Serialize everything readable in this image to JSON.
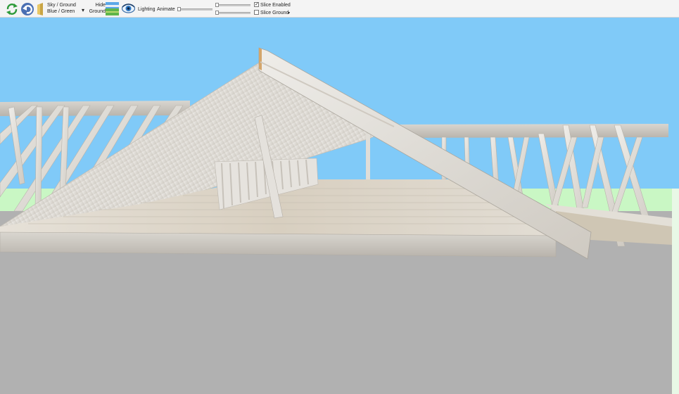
{
  "toolbar": {
    "sky_ground_label_1": "Sky / Ground",
    "sky_ground_label_2": "Blue / Green",
    "hide_ground_label_1": "Hide",
    "hide_ground_label_2": "Ground",
    "lighting_label": "Lighting",
    "animate_label": "Animate",
    "slice_enabled_label": "Slice Enabled",
    "slice_enabled_checked": true,
    "slice_ground_label": "Slice Ground",
    "slice_ground_checked": false,
    "dropdown_arrow": "▾",
    "check_mark": "✓"
  },
  "icons": {
    "refresh": "refresh-icon",
    "undo": "undo-icon",
    "door": "door-icon",
    "landscape": "landscape-icon",
    "eye": "eye-icon"
  },
  "colors": {
    "sky": "#80caf8",
    "ground": "#c9f7c4",
    "floor": "#b1b1b1",
    "lumber": "#e4e2dd",
    "toolbar": "#f4f4f4"
  }
}
